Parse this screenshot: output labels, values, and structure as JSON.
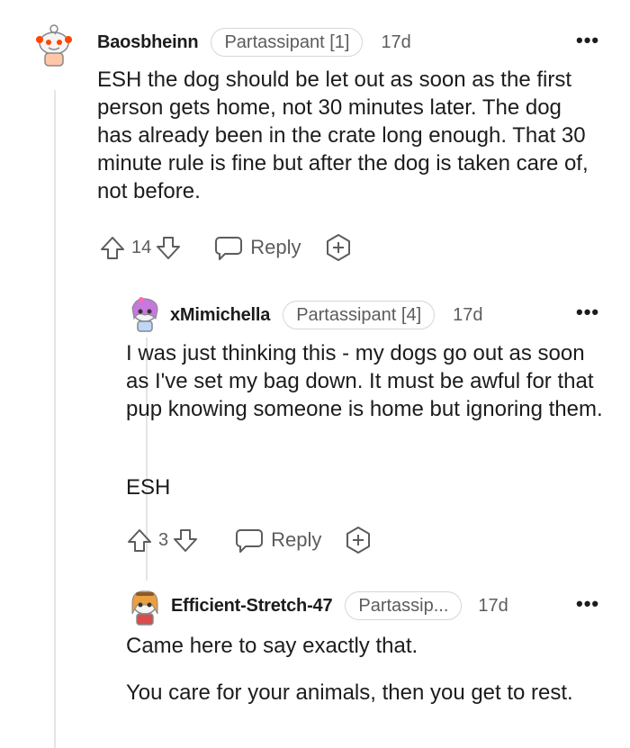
{
  "comments": [
    {
      "username": "Baosbheinn",
      "flair": "Partassipant [1]",
      "age": "17d",
      "body": [
        "ESH the dog should be let out as soon as the first person gets home, not 30 minutes later. The dog has already been in the crate long enough. That 30 minute rule is fine but after the dog is taken care of, not before."
      ],
      "score": "14",
      "reply_label": "Reply"
    },
    {
      "username": "xMimichella",
      "flair": "Partassipant [4]",
      "age": "17d",
      "body": [
        "I was just thinking this - my dogs go out as soon as I've set my bag down. It must be awful for that pup knowing someone is home but ignoring them.",
        "ESH"
      ],
      "score": "3",
      "reply_label": "Reply"
    },
    {
      "username": "Efficient-Stretch-47",
      "flair": "Partassip...",
      "age": "17d",
      "body": [
        "Came here to say exactly that.",
        "You care for your animals, then you get to rest."
      ]
    }
  ],
  "more_glyph": "•••",
  "colors": {
    "text": "#1c1c1c",
    "meta": "#5c5c5c",
    "border": "#d6d6d6",
    "thread": "#e5e5e5",
    "avatar1": "#ff4500",
    "avatar2": "#c678dd",
    "avatar3": "#e8a040"
  },
  "icons": [
    "avatar",
    "upvote-icon",
    "downvote-icon",
    "reply-bubble-icon",
    "award-icon",
    "more-options-icon"
  ]
}
